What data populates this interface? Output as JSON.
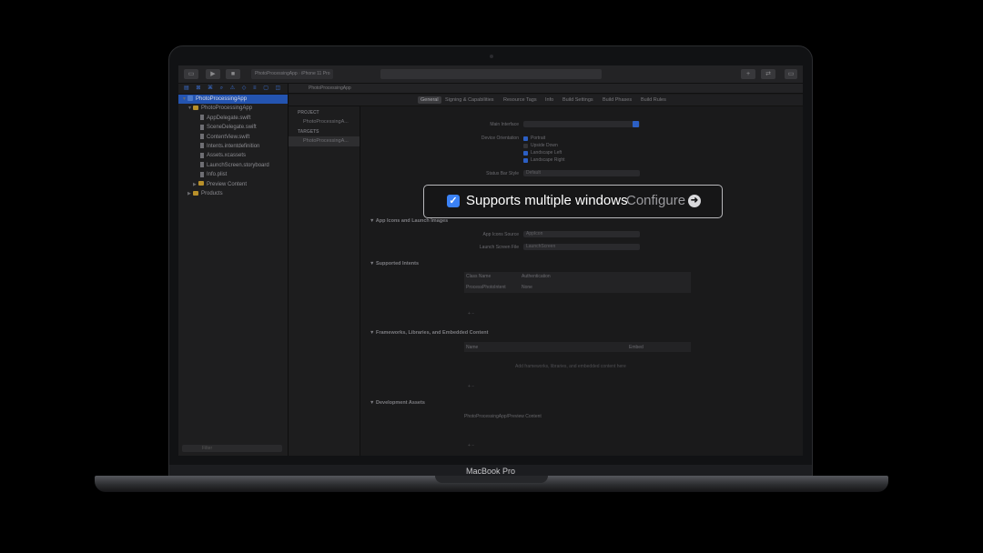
{
  "toolbar": {
    "scheme": "PhotoProcessingApp",
    "device": "iPhone 11 Pro"
  },
  "navigator": {
    "items": [
      {
        "label": "PhotoProcessingApp",
        "kind": "project"
      },
      {
        "label": "PhotoProcessingApp",
        "kind": "folder"
      },
      {
        "label": "AppDelegate.swift",
        "kind": "file"
      },
      {
        "label": "SceneDelegate.swift",
        "kind": "file"
      },
      {
        "label": "ContentView.swift",
        "kind": "file"
      },
      {
        "label": "Intents.intentdefinition",
        "kind": "file"
      },
      {
        "label": "Assets.xcassets",
        "kind": "file"
      },
      {
        "label": "LaunchScreen.storyboard",
        "kind": "file"
      },
      {
        "label": "Info.plist",
        "kind": "file"
      },
      {
        "label": "Preview Content",
        "kind": "folder"
      },
      {
        "label": "Products",
        "kind": "folder"
      }
    ],
    "filter_placeholder": "Filter"
  },
  "jumpbar": {
    "path": "PhotoProcessingApp"
  },
  "tabs": [
    "General",
    "Signing & Capabilities",
    "Resource Tags",
    "Info",
    "Build Settings",
    "Build Phases",
    "Build Rules"
  ],
  "targets_panel": {
    "project_header": "PROJECT",
    "project_item": "PhotoProcessingA...",
    "targets_header": "TARGETS",
    "target_item": "PhotoProcessingA...",
    "filter_placeholder": "Filter"
  },
  "editor": {
    "main_interface_label": "Main Interface",
    "device_orientation_label": "Device Orientation",
    "orientations": [
      {
        "label": "Portrait",
        "checked": true
      },
      {
        "label": "Upside Down",
        "checked": false
      },
      {
        "label": "Landscape Left",
        "checked": true
      },
      {
        "label": "Landscape Right",
        "checked": true
      }
    ],
    "status_bar_label": "Status Bar Style",
    "status_bar_value": "Default",
    "app_icons_section": "App Icons and Launch Images",
    "app_icons_source_label": "App Icons Source",
    "app_icons_source_value": "AppIcon",
    "launch_screen_label": "Launch Screen File",
    "launch_screen_value": "LaunchScreen",
    "intents_section": "Supported Intents",
    "intents_col1": "Class Name",
    "intents_col2": "Authentication",
    "intents_row_class": "ProcessPhotoIntent",
    "intents_row_auth": "None",
    "frameworks_section": "Frameworks, Libraries, and Embedded Content",
    "frameworks_col1": "Name",
    "frameworks_col2": "Embed",
    "frameworks_empty": "Add frameworks, libraries, and embedded content here",
    "dev_assets_section": "Development Assets",
    "dev_assets_path": "PhotoProcessingApp/Preview Content"
  },
  "callout": {
    "text": "Supports multiple windows",
    "configure": "Configure",
    "checked": true
  },
  "laptop_label": "MacBook Pro"
}
